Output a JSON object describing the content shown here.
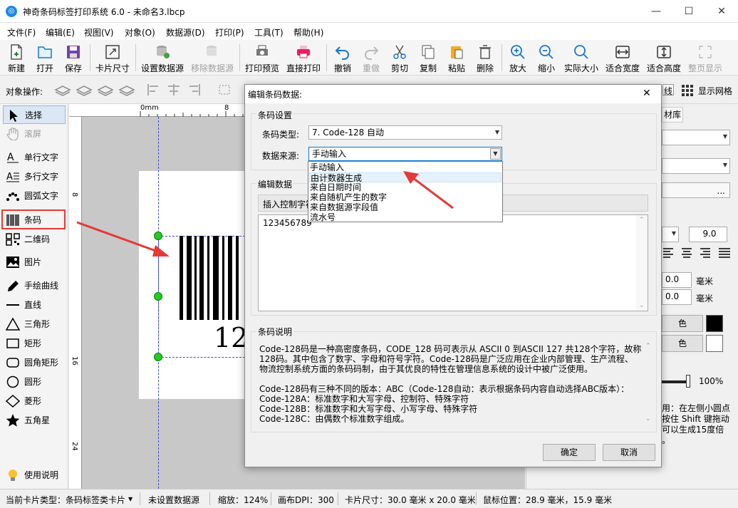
{
  "window": {
    "title": "神奇条码标签打印系统 6.0 - 未命名3.lbcp",
    "app_icon": "app-logo-icon",
    "minimize": "—",
    "maximize": "☐",
    "close": "✕"
  },
  "menu": [
    "文件(F)",
    "编辑(E)",
    "视图(V)",
    "对象(O)",
    "数据源(D)",
    "打印(P)",
    "工具(T)",
    "帮助(H)"
  ],
  "toolbar": [
    {
      "label": "新建",
      "icon": "new-file-icon"
    },
    {
      "label": "打开",
      "icon": "open-folder-icon"
    },
    {
      "label": "保存",
      "icon": "save-icon"
    },
    {
      "label": "卡片尺寸",
      "icon": "card-size-icon"
    },
    {
      "label": "设置数据源",
      "icon": "database-icon"
    },
    {
      "label": "移除数据源",
      "icon": "remove-database-icon",
      "disabled": true
    },
    {
      "label": "打印预览",
      "icon": "print-preview-icon"
    },
    {
      "label": "直接打印",
      "icon": "printer-icon"
    },
    {
      "label": "撤销",
      "icon": "undo-icon"
    },
    {
      "label": "重做",
      "icon": "redo-icon",
      "disabled": true
    },
    {
      "label": "剪切",
      "icon": "scissors-icon"
    },
    {
      "label": "复制",
      "icon": "copy-icon"
    },
    {
      "label": "粘贴",
      "icon": "paste-icon"
    },
    {
      "label": "删除",
      "icon": "trash-icon"
    },
    {
      "label": "放大",
      "icon": "zoom-in-icon"
    },
    {
      "label": "缩小",
      "icon": "zoom-out-icon"
    },
    {
      "label": "实际大小",
      "icon": "actual-size-icon"
    },
    {
      "label": "适合宽度",
      "icon": "fit-width-icon"
    },
    {
      "label": "适合高度",
      "icon": "fit-height-icon"
    },
    {
      "label": "整页显示",
      "icon": "full-page-icon",
      "disabled": true
    }
  ],
  "ops": {
    "label": "对象操作:",
    "grid_label": "显示网格",
    "line_label": "线"
  },
  "tools": [
    {
      "label": "选择",
      "icon": "cursor-arrow-icon"
    },
    {
      "label": "滚屏",
      "icon": "hand-icon"
    },
    {
      "label": "单行文字",
      "icon": "single-line-text-icon"
    },
    {
      "label": "多行文字",
      "icon": "multi-line-text-icon"
    },
    {
      "label": "圆弧文字",
      "icon": "arc-text-icon"
    },
    {
      "label": "条码",
      "icon": "barcode-icon"
    },
    {
      "label": "二维码",
      "icon": "qrcode-icon"
    },
    {
      "label": "图片",
      "icon": "image-icon"
    },
    {
      "label": "手绘曲线",
      "icon": "pen-icon"
    },
    {
      "label": "直线",
      "icon": "line-icon"
    },
    {
      "label": "三角形",
      "icon": "triangle-icon"
    },
    {
      "label": "矩形",
      "icon": "rectangle-icon"
    },
    {
      "label": "圆角矩形",
      "icon": "rounded-rect-icon"
    },
    {
      "label": "圆形",
      "icon": "circle-icon"
    },
    {
      "label": "菱形",
      "icon": "diamond-icon"
    },
    {
      "label": "五角星",
      "icon": "star-icon"
    },
    {
      "label": "使用说明",
      "icon": "lightbulb-icon"
    }
  ],
  "ruler": {
    "top_zero": "0mm",
    "top_8": "8",
    "left_8": "8",
    "left_16": "16",
    "left_24": "24"
  },
  "canvas": {
    "barcode_digits": "12"
  },
  "right_panel": {
    "tab": "材库",
    "font_size": "9.0",
    "offset1": "0.0",
    "offset2": "0.0",
    "unit1": "毫米",
    "unit2": "毫米",
    "opacity": "100%",
    "dots": "...",
    "hint_line1": "用：在左侧小圆点",
    "hint_line2": "按住 Shift 键拖动",
    "hint_line3": "可以生成15度倍",
    "hint_line4": "。",
    "color_btn1": "色",
    "color_btn2": "色"
  },
  "dialog": {
    "title": "编辑条码数据:",
    "close": "✕",
    "settings_group": "条码设置",
    "type_label": "条码类型:",
    "type_value": "7. Code-128 自动",
    "source_label": "数据来源:",
    "source_value": "手动输入",
    "edit_group": "编辑数据",
    "insert_ctrl": "插入控制字符",
    "data_value": "123456789",
    "desc_group": "条码说明",
    "desc_lines": [
      "Code-128码是一种高密度条码，CODE_128 码可表示从 ASCII 0 到ASCII 127 共128个字符，故称",
      "128码。其中包含了数字、字母和符号字符。Code-128码是广泛应用在企业内部管理、生产流程、",
      "物流控制系统方面的条码码制，由于其优良的特性在管理信息系统的设计中被广泛使用。",
      "",
      "Code-128码有三种不同的版本：ABC（Code-128自动：表示根据条码内容自动选择ABC版本）：",
      "Code-128A：标准数字和大写字母、控制符、特殊字符",
      "Code-128B：标准数字和大写字母、小写字母、特殊字符",
      "Code-128C：由偶数个标准数字组成。"
    ],
    "ok": "确定",
    "cancel": "取消",
    "options": [
      "手动输入",
      "由计数器生成",
      "来自日期时间",
      "来自随机产生的数字",
      "来自数据源字段值",
      "流水号"
    ]
  },
  "status": {
    "card_type": "当前卡片类型：",
    "card_type_value": "条码标签类卡片",
    "datasource": "未设置数据源",
    "zoom": "缩放：124%",
    "dpi": "画布DPI：300",
    "card_size": "卡片尺寸：30.0 毫米 x 20.0 毫米",
    "mouse": "鼠标位置：28.9 毫米，15.9 毫米"
  },
  "colors": {
    "accent": "#1e88e5",
    "arrow": "#e53935",
    "highlight_border": "#e53935",
    "handle": "#22cc22"
  }
}
